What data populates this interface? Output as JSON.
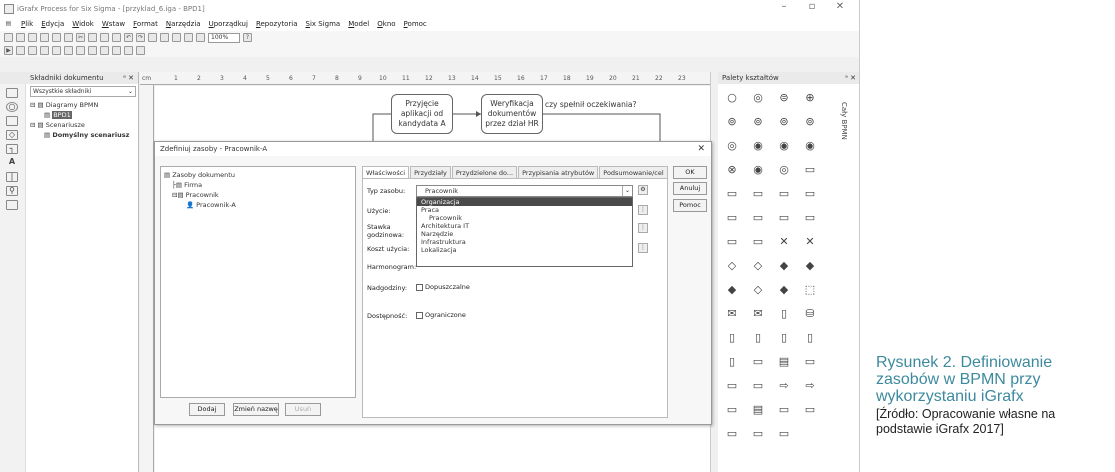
{
  "window": {
    "title": "iGrafx Process for Six Sigma - [przyklad_6.iga - BPD1]"
  },
  "menu": [
    "Plik",
    "Edycja",
    "Widok",
    "Wstaw",
    "Format",
    "Narzędzia",
    "Uporządkuj",
    "Repozytoria",
    "Six Sigma",
    "Model",
    "Okno",
    "Pomoc"
  ],
  "toolbar": {
    "zoom": "100%"
  },
  "left_panel": {
    "title": "Składniki dokumentu",
    "filter": "Wszystkie składniki",
    "tree": [
      "Diagramy BPMN",
      "BPD1",
      "Scenariusze",
      "Domyślny scenariusz"
    ]
  },
  "canvas": {
    "ruler_unit": "cm",
    "ruler_ticks": [
      "1",
      "2",
      "3",
      "4",
      "5",
      "6",
      "7",
      "8",
      "9",
      "10",
      "11",
      "12",
      "13",
      "14",
      "15",
      "16",
      "17",
      "18",
      "19",
      "20",
      "21",
      "22",
      "23"
    ],
    "shapes": [
      {
        "text": "Przyjęcie aplikacji od kandydata A"
      },
      {
        "text": "Weryfikacja dokumentów przez dział HR"
      }
    ],
    "annotation": "czy spełnił oczekiwania?"
  },
  "dialog": {
    "title": "Zdefiniuj zasoby - Pracownik-A",
    "tree": [
      "Zasoby dokumentu",
      "Firma",
      "Pracownik",
      "Pracownik-A"
    ],
    "buttons": {
      "ok": "OK",
      "cancel": "Anuluj",
      "help": "Pomoc",
      "add": "Dodaj",
      "rename": "Zmień nazwę",
      "delete": "Usuń"
    },
    "tabs": [
      "Właściwości",
      "Przydziały",
      "Przydzielone do...",
      "Przypisania atrybutów",
      "Podsumowanie/cel"
    ],
    "fields": {
      "type_label": "Typ zasobu:",
      "type_value": "Pracownik",
      "use_label": "Użycie:",
      "rate_label": "Stawka godzinowa:",
      "cost_label": "Koszt użycia:",
      "schedule_label": "Harmonogram:",
      "super_label": "Nadgodziny:",
      "super_check": "Dopuszczalne",
      "avail_label": "Dostępność:",
      "avail_check": "Ograniczone"
    },
    "dropdown": [
      "Organizacja",
      "Praca",
      "Pracownik",
      "Architektura IT",
      "Narzędzie",
      "Infrastruktura",
      "Lokalizacja"
    ]
  },
  "palette": {
    "title": "Palety kształtów",
    "side_tab": "Cały BPMN"
  },
  "caption": {
    "label": "Rysunek 2.",
    "title": "Definiowanie zasobów w BPMN przy wykorzystaniu iGrafx",
    "source": "[Źródło: Opracowanie własne na podstawie iGrafx 2017]"
  }
}
